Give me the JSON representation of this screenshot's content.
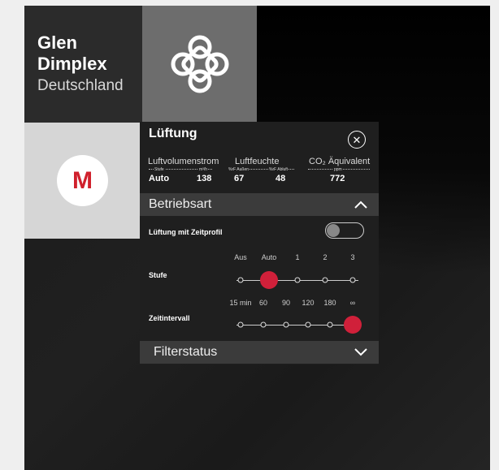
{
  "brand": {
    "line1": "Glen",
    "line2": "Dimplex",
    "line3": "Deutschland"
  },
  "app_tile": {
    "letter": "M"
  },
  "panel": {
    "title": "Lüftung",
    "metrics": [
      {
        "label": "Luftvolumenstrom",
        "sub_left": "Stufe",
        "sub_right": "m³/h",
        "value_left": "Auto",
        "value_right": "138"
      },
      {
        "label": "Luftfeuchte",
        "sub_left": "%rF Außen",
        "sub_right": "%rF Abluft",
        "value_left": "67",
        "value_right": "48"
      },
      {
        "label": "CO₂ Äquivalent",
        "sub": "ppm",
        "value": "772"
      }
    ],
    "section_mode": "Betriebsart",
    "toggle_label": "Lüftung mit Zeitprofil",
    "toggle_on": false,
    "stufe": {
      "label": "Stufe",
      "options": [
        "Aus",
        "Auto",
        "1",
        "2",
        "3"
      ],
      "selected": "Auto"
    },
    "zeit": {
      "label": "Zeitintervall",
      "options": [
        "15 min",
        "60",
        "90",
        "120",
        "180",
        "∞"
      ],
      "selected": "∞"
    },
    "section_filter": "Filterstatus"
  },
  "colors": {
    "accent": "#d0203a",
    "panel": "#1f1f1f",
    "section": "#3b3b3b"
  }
}
